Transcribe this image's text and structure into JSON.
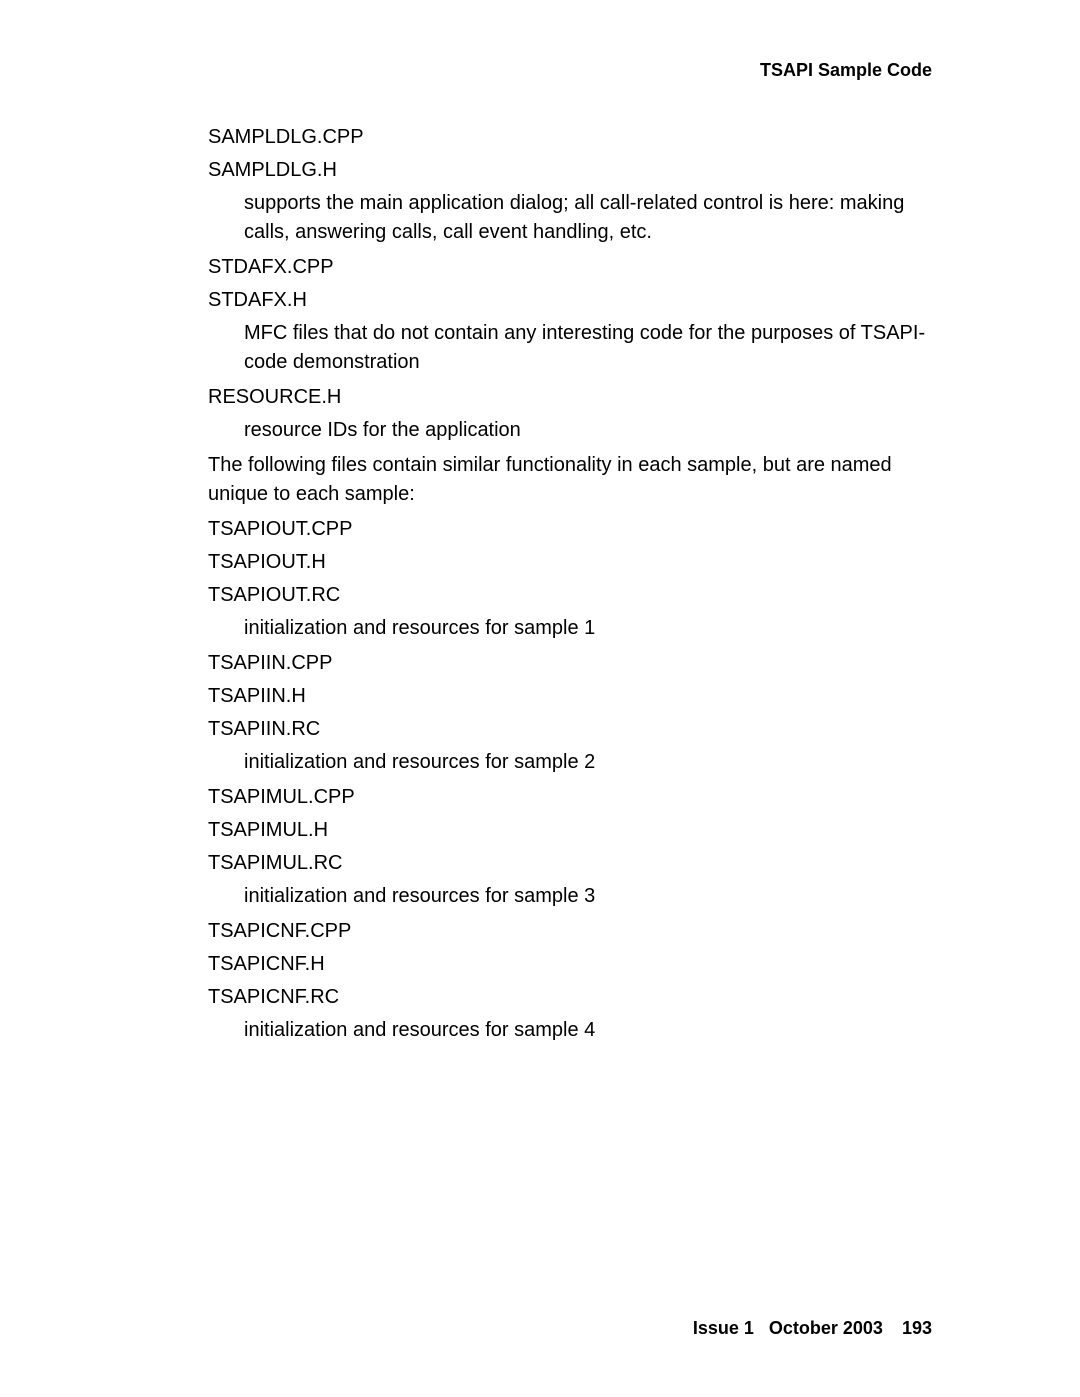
{
  "header": {
    "title": "TSAPI Sample Code"
  },
  "content": {
    "blocks": [
      {
        "type": "term",
        "text": "SAMPLDLG.CPP"
      },
      {
        "type": "term",
        "text": "SAMPLDLG.H"
      },
      {
        "type": "desc",
        "text": "supports the main application dialog; all call-related control is here: making calls, answering calls, call event handling, etc."
      },
      {
        "type": "term",
        "text": "STDAFX.CPP"
      },
      {
        "type": "term",
        "text": "STDAFX.H"
      },
      {
        "type": "desc",
        "text": "MFC files that do not contain any interesting code for the purposes of TSAPI-code demonstration"
      },
      {
        "type": "term",
        "text": "RESOURCE.H"
      },
      {
        "type": "desc",
        "text": "resource IDs for the application"
      },
      {
        "type": "para",
        "text": "The following files contain similar functionality in each sample, but are named unique to each sample:"
      },
      {
        "type": "term",
        "text": "TSAPIOUT.CPP"
      },
      {
        "type": "term",
        "text": "TSAPIOUT.H"
      },
      {
        "type": "term",
        "text": "TSAPIOUT.RC"
      },
      {
        "type": "desc",
        "text": "initialization and resources for sample 1"
      },
      {
        "type": "term",
        "text": "TSAPIIN.CPP"
      },
      {
        "type": "term",
        "text": "TSAPIIN.H"
      },
      {
        "type": "term",
        "text": "TSAPIIN.RC"
      },
      {
        "type": "desc",
        "text": "initialization and resources for sample 2"
      },
      {
        "type": "term",
        "text": "TSAPIMUL.CPP"
      },
      {
        "type": "term",
        "text": "TSAPIMUL.H"
      },
      {
        "type": "term",
        "text": "TSAPIMUL.RC"
      },
      {
        "type": "desc",
        "text": "initialization and resources for sample 3"
      },
      {
        "type": "term",
        "text": "TSAPICNF.CPP"
      },
      {
        "type": "term",
        "text": "TSAPICNF.H"
      },
      {
        "type": "term",
        "text": "TSAPICNF.RC"
      },
      {
        "type": "desc",
        "text": "initialization and resources for sample 4"
      }
    ]
  },
  "footer": {
    "issue": "Issue 1",
    "date": "October 2003",
    "page": "193"
  }
}
